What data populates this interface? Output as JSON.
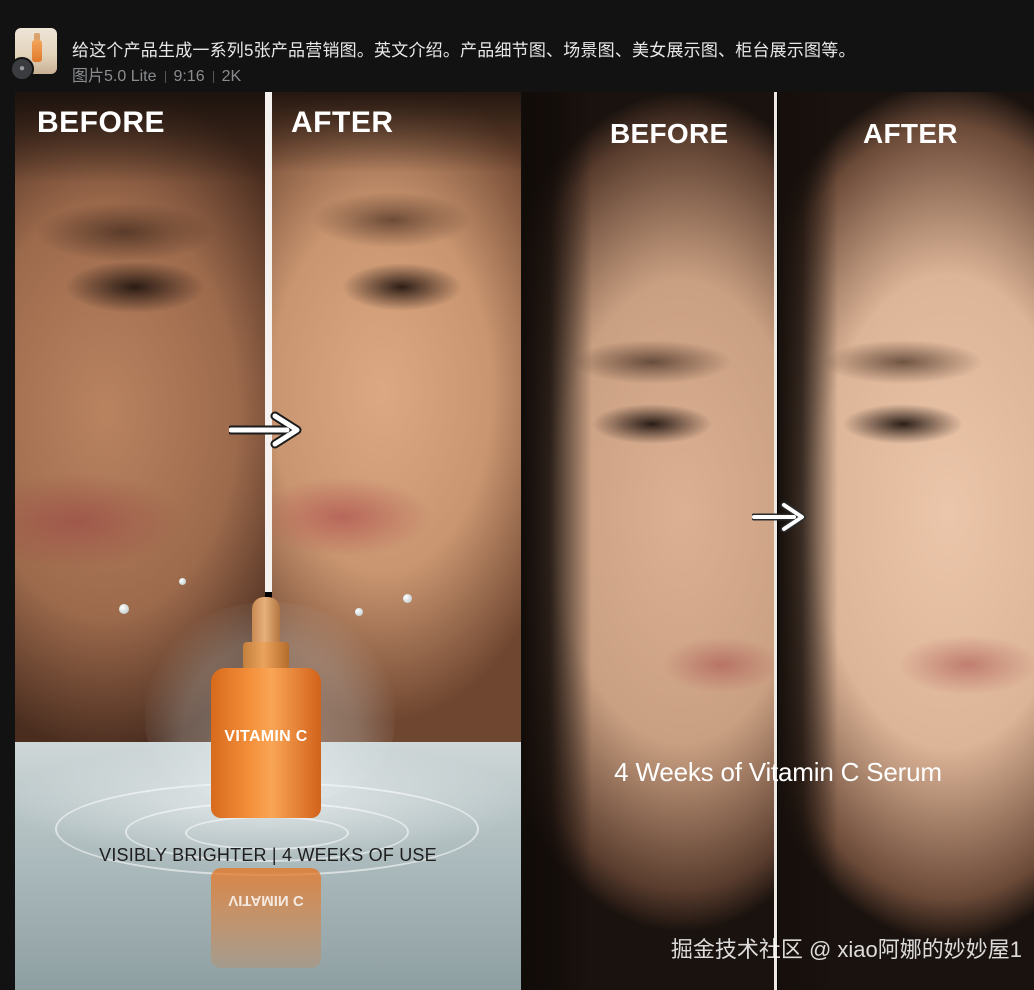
{
  "message": {
    "prompt": "给这个产品生成一系列5张产品营销图。英文介绍。产品细节图、场景图、美女展示图、柜台展示图等。",
    "model": "图片5.0 Lite",
    "aspect_ratio": "9:16",
    "resolution": "2K"
  },
  "image": {
    "left_panel": {
      "before_label": "BEFORE",
      "after_label": "AFTER",
      "bottle_label": "VITAMIN C",
      "caption": "VISIBLY BRIGHTER | 4 WEEKS OF USE"
    },
    "right_panel": {
      "before_label": "BEFORE",
      "after_label": "AFTER",
      "caption": "4 Weeks of Vitamin C Serum"
    },
    "watermark": "掘金技术社区 @ xiao阿娜的妙妙屋1"
  }
}
